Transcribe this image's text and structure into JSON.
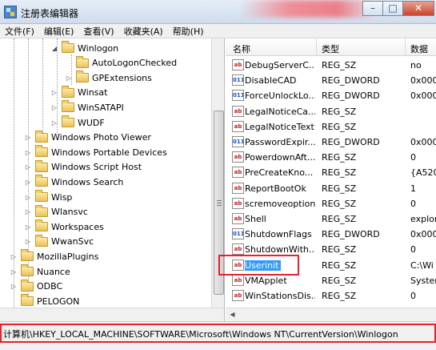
{
  "window": {
    "title": "注册表编辑器"
  },
  "menu": [
    "文件(F)",
    "编辑(E)",
    "查看(V)",
    "收藏夹(A)",
    "帮助(H)"
  ],
  "tree": [
    {
      "label": "Winlogon",
      "level": 4,
      "expander": "open"
    },
    {
      "label": "AutoLogonChecked",
      "level": 5,
      "expander": ""
    },
    {
      "label": "GPExtensions",
      "level": 5,
      "expander": "closed"
    },
    {
      "label": "Winsat",
      "level": 4,
      "expander": "closed"
    },
    {
      "label": "WinSATAPI",
      "level": 4,
      "expander": "closed"
    },
    {
      "label": "WUDF",
      "level": 4,
      "expander": "closed"
    },
    {
      "label": "Windows Photo Viewer",
      "level": 2,
      "expander": "closed"
    },
    {
      "label": "Windows Portable Devices",
      "level": 2,
      "expander": "closed"
    },
    {
      "label": "Windows Script Host",
      "level": 2,
      "expander": "closed"
    },
    {
      "label": "Windows Search",
      "level": 2,
      "expander": "closed"
    },
    {
      "label": "Wisp",
      "level": 2,
      "expander": "closed"
    },
    {
      "label": "Wlansvc",
      "level": 2,
      "expander": "closed"
    },
    {
      "label": "Workspaces",
      "level": 2,
      "expander": "closed"
    },
    {
      "label": "WwanSvc",
      "level": 2,
      "expander": "closed"
    },
    {
      "label": "MozillaPlugins",
      "level": 1,
      "expander": "closed"
    },
    {
      "label": "Nuance",
      "level": 1,
      "expander": "closed"
    },
    {
      "label": "ODBC",
      "level": 1,
      "expander": "closed"
    },
    {
      "label": "PELOGON",
      "level": 1,
      "expander": ""
    }
  ],
  "list": {
    "headers": [
      "名称",
      "类型",
      "数据"
    ],
    "rows": [
      {
        "name": "DebugServerC...",
        "type": "REG_SZ",
        "data": "no",
        "icon": "sz"
      },
      {
        "name": "DisableCAD",
        "type": "REG_DWORD",
        "data": "0x000",
        "icon": "dword"
      },
      {
        "name": "ForceUnlockLo...",
        "type": "REG_DWORD",
        "data": "0x000",
        "icon": "dword"
      },
      {
        "name": "LegalNoticeCa...",
        "type": "REG_SZ",
        "data": "",
        "icon": "sz"
      },
      {
        "name": "LegalNoticeText",
        "type": "REG_SZ",
        "data": "",
        "icon": "sz"
      },
      {
        "name": "PasswordExpir...",
        "type": "REG_DWORD",
        "data": "0x000",
        "icon": "dword"
      },
      {
        "name": "PowerdownAft...",
        "type": "REG_SZ",
        "data": "0",
        "icon": "sz"
      },
      {
        "name": "PreCreateKno...",
        "type": "REG_SZ",
        "data": "{A520",
        "icon": "sz"
      },
      {
        "name": "ReportBootOk",
        "type": "REG_SZ",
        "data": "1",
        "icon": "sz"
      },
      {
        "name": "scremoveoption",
        "type": "REG_SZ",
        "data": "0",
        "icon": "sz"
      },
      {
        "name": "Shell",
        "type": "REG_SZ",
        "data": "explor",
        "icon": "sz"
      },
      {
        "name": "ShutdownFlags",
        "type": "REG_DWORD",
        "data": "0x000",
        "icon": "dword"
      },
      {
        "name": "ShutdownWith...",
        "type": "REG_SZ",
        "data": "0",
        "icon": "sz"
      },
      {
        "name": "Userinit",
        "type": "REG_SZ",
        "data": "C:\\Wi",
        "icon": "sz",
        "selected": true
      },
      {
        "name": "VMApplet",
        "type": "REG_SZ",
        "data": "Syster",
        "icon": "sz"
      },
      {
        "name": "WinStationsDis...",
        "type": "REG_SZ",
        "data": "0",
        "icon": "sz"
      }
    ]
  },
  "status": {
    "path": "计算机\\HKEY_LOCAL_MACHINE\\SOFTWARE\\Microsoft\\Windows NT\\CurrentVersion\\Winlogon"
  },
  "icons": {
    "app": "registry-editor-icon",
    "folder": "folder-icon",
    "sz": "ab-icon",
    "dword": "binary-icon",
    "sz_glyph": "ab",
    "dword_glyph": "011"
  },
  "colors": {
    "highlight_box": "#e8212b",
    "selection": "#3399ff"
  }
}
